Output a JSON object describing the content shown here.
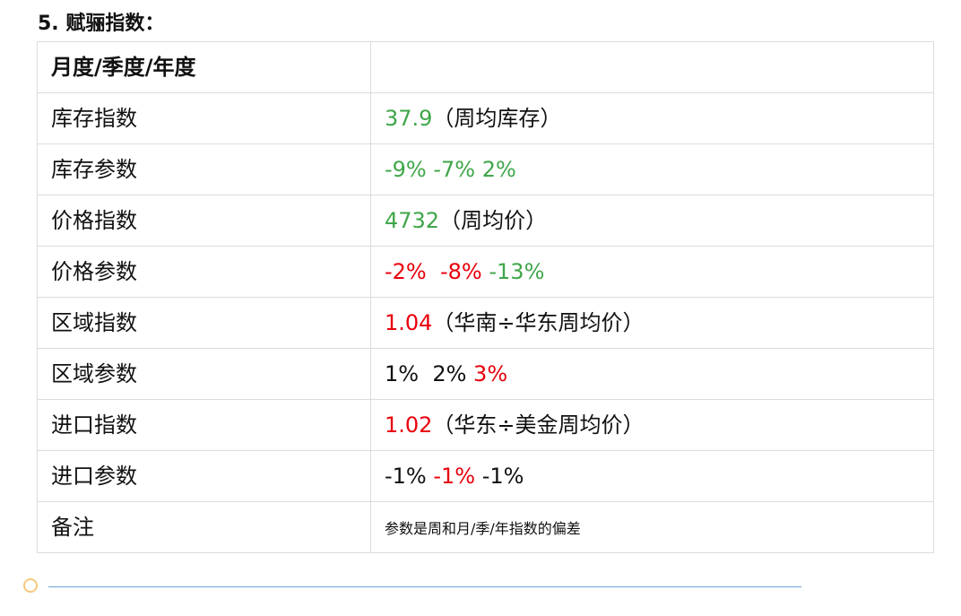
{
  "heading": "5. 赋骊指数：",
  "colors": {
    "green": "#3fa64a",
    "red": "#e8000b",
    "black": "#111111"
  },
  "table": {
    "header": {
      "label": "月度/季度/年度",
      "value": ""
    },
    "rows": [
      {
        "label": "库存指数",
        "segments": [
          {
            "text": "37.9",
            "color": "#3fa64a"
          },
          {
            "text": "（周均库存）",
            "color": "#111111"
          }
        ]
      },
      {
        "label": "库存参数",
        "segments": [
          {
            "text": "-9%",
            "color": "#3fa64a"
          },
          {
            "text": " -7%",
            "color": "#3fa64a"
          },
          {
            "text": " 2%",
            "color": "#3fa64a"
          }
        ]
      },
      {
        "label": "价格指数",
        "segments": [
          {
            "text": "4732",
            "color": "#3fa64a"
          },
          {
            "text": "（周均价）",
            "color": "#111111"
          }
        ]
      },
      {
        "label": "价格参数",
        "segments": [
          {
            "text": "-2%",
            "color": "#e8000b"
          },
          {
            "text": "  -8%",
            "color": "#e8000b"
          },
          {
            "text": " -13%",
            "color": "#3fa64a"
          }
        ]
      },
      {
        "label": "区域指数",
        "segments": [
          {
            "text": "1.04",
            "color": "#e8000b"
          },
          {
            "text": "（华南÷华东周均价）",
            "color": "#111111"
          }
        ]
      },
      {
        "label": "区域参数",
        "segments": [
          {
            "text": "1%",
            "color": "#111111"
          },
          {
            "text": "  2%",
            "color": "#111111"
          },
          {
            "text": " 3%",
            "color": "#e8000b"
          }
        ]
      },
      {
        "label": "进口指数",
        "segments": [
          {
            "text": "1.02",
            "color": "#e8000b"
          },
          {
            "text": "（华东÷美金周均价）",
            "color": "#111111"
          }
        ]
      },
      {
        "label": "进口参数",
        "segments": [
          {
            "text": "-1%",
            "color": "#111111"
          },
          {
            "text": " -1%",
            "color": "#e8000b"
          },
          {
            "text": " -1%",
            "color": "#111111"
          }
        ]
      }
    ],
    "note": {
      "label": "备注",
      "value": "参数是周和月/季/年指数的偏差"
    }
  }
}
